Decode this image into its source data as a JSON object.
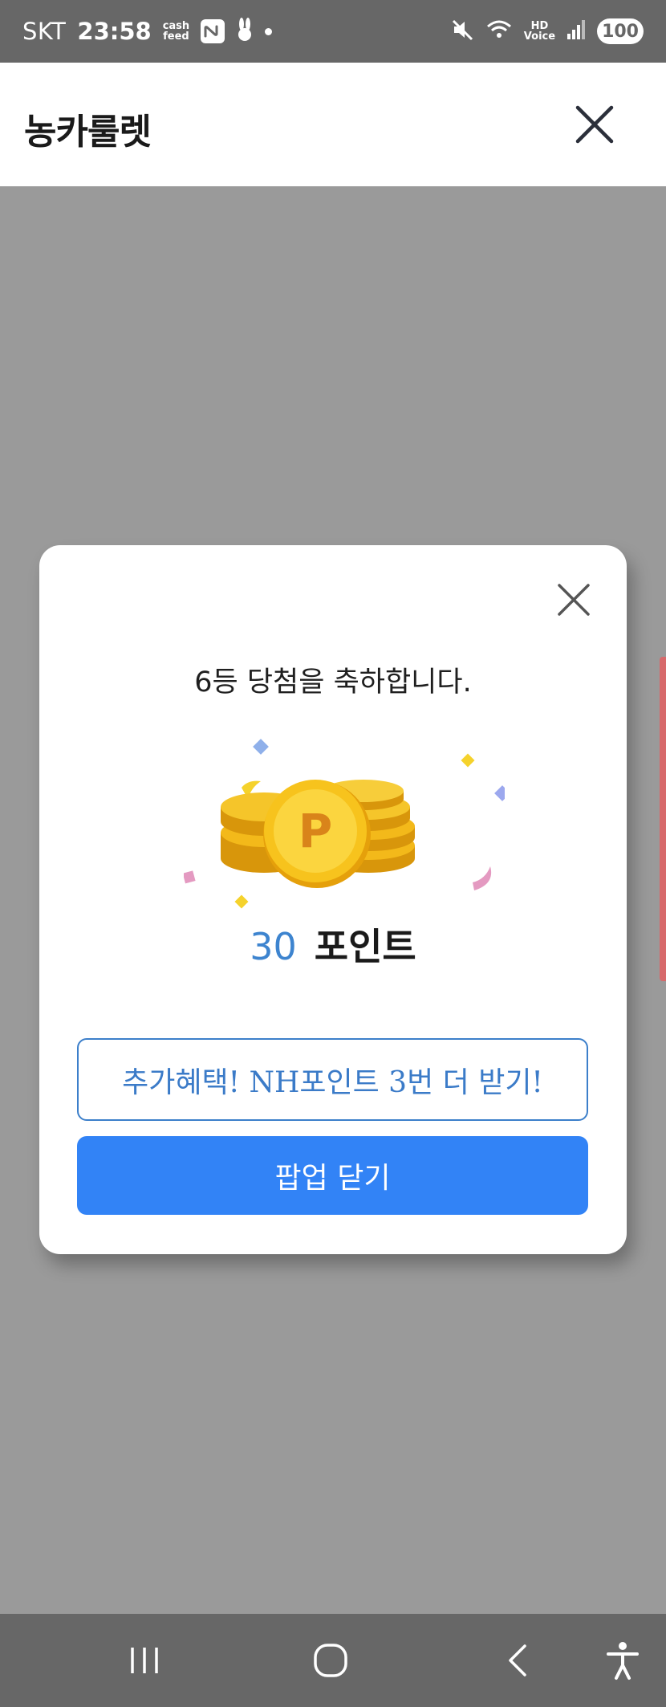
{
  "status_bar": {
    "carrier": "SKT",
    "time": "23:58",
    "cashfeed_label_line1": "cash",
    "cashfeed_label_line2": "feed",
    "hd_voice_line1": "HD",
    "hd_voice_line2": "Voice",
    "battery": "100"
  },
  "header": {
    "title": "농카룰렛"
  },
  "modal": {
    "title": "6등 당첨을 축하합니다.",
    "coin_letter": "P",
    "points_value": "30",
    "points_unit": "포인트",
    "extra_benefit_button": "추가혜택! NH포인트 3번 더 받기!",
    "close_popup_button": "팝업 닫기"
  },
  "colors": {
    "primary_button": "#3283f6",
    "outline_button": "#3c7fca",
    "points_value": "#3d84cf",
    "coin_gold": "#f5b800",
    "coin_letter": "#d9841a"
  },
  "icons": [
    "mute-icon",
    "wifi-icon",
    "signal-icon",
    "recent-apps-icon",
    "home-icon",
    "back-icon",
    "accessibility-icon",
    "close-icon",
    "coin-icon"
  ]
}
